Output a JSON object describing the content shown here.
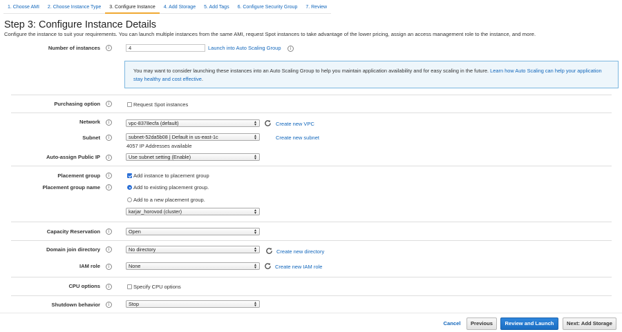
{
  "tabs": [
    {
      "label": "1. Choose AMI"
    },
    {
      "label": "2. Choose Instance Type"
    },
    {
      "label": "3. Configure Instance"
    },
    {
      "label": "4. Add Storage"
    },
    {
      "label": "5. Add Tags"
    },
    {
      "label": "6. Configure Security Group"
    },
    {
      "label": "7. Review"
    }
  ],
  "active_tab": "3. Configure Instance",
  "page": {
    "title": "Step 3: Configure Instance Details",
    "description": "Configure the instance to suit your requirements. You can launch multiple instances from the same AMI, request Spot instances to take advantage of the lower pricing, assign an access management role to the instance, and more."
  },
  "form": {
    "num_instances": {
      "label": "Number of instances",
      "value": "4",
      "asg_link": "Launch into Auto Scaling Group"
    },
    "infobox": {
      "text": "You may want to consider launching these instances into an Auto Scaling Group to help you maintain application availability and for easy scaling in the future. ",
      "link": "Learn how Auto Scaling can help your application stay healthy and cost effective",
      "suffix": "."
    },
    "purchasing": {
      "label": "Purchasing option",
      "checkbox_label": "Request Spot instances",
      "checked": false
    },
    "network": {
      "label": "Network",
      "value": "vpc-8378ecfa (default)",
      "link": "Create new VPC"
    },
    "subnet": {
      "label": "Subnet",
      "value": "subnet-52da5b08 | Default in us-east-1c",
      "link": "Create new subnet",
      "available": "4057 IP Addresses available"
    },
    "public_ip": {
      "label": "Auto-assign Public IP",
      "value": "Use subnet setting (Enable)"
    },
    "placement_group": {
      "label": "Placement group",
      "checkbox_label": "Add instance to placement group",
      "checked": true
    },
    "placement_group_name": {
      "label": "Placement group name",
      "option_existing": "Add to existing placement group.",
      "option_new": "Add to a new placement group.",
      "selected": "existing",
      "value": "karjar_horovod (cluster)"
    },
    "capacity": {
      "label": "Capacity Reservation",
      "value": "Open"
    },
    "domain": {
      "label": "Domain join directory",
      "value": "No directory",
      "link": "Create new directory"
    },
    "iam": {
      "label": "IAM role",
      "value": "None",
      "link": "Create new IAM role"
    },
    "cpu": {
      "label": "CPU options",
      "checkbox_label": "Specify CPU options",
      "checked": false
    },
    "shutdown": {
      "label": "Shutdown behavior",
      "value": "Stop"
    }
  },
  "footer": {
    "cancel": "Cancel",
    "previous": "Previous",
    "review_launch": "Review and Launch",
    "next": "Next: Add Storage"
  },
  "colors": {
    "accent": "#1166bb",
    "primary_button": "#1b6ec2",
    "active_tab_underline": "#f0a830",
    "infobox_bg": "#eef6fb",
    "infobox_border": "#7cb7df"
  }
}
